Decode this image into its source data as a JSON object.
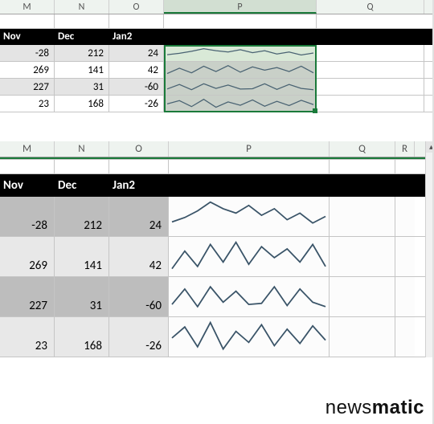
{
  "top": {
    "columns": {
      "M": "M",
      "N": "N",
      "O": "O",
      "P": "P",
      "Q": "Q"
    },
    "months": {
      "nov": "Nov",
      "dec": "Dec",
      "jan2": "Jan2"
    },
    "rows": [
      {
        "nov": "-28",
        "dec": "212",
        "jan2": "24"
      },
      {
        "nov": "269",
        "dec": "141",
        "jan2": "42"
      },
      {
        "nov": "227",
        "dec": "31",
        "jan2": "-60"
      },
      {
        "nov": "23",
        "dec": "168",
        "jan2": "-26"
      }
    ],
    "selected_column": "P"
  },
  "bot": {
    "columns": {
      "M": "M",
      "N": "N",
      "O": "O",
      "P": "P",
      "Q": "Q",
      "R": "R"
    },
    "months": {
      "nov": "Nov",
      "dec": "Dec",
      "jan2": "Jan2"
    },
    "rows": [
      {
        "nov": "-28",
        "dec": "212",
        "jan2": "24"
      },
      {
        "nov": "269",
        "dec": "141",
        "jan2": "42"
      },
      {
        "nov": "227",
        "dec": "31",
        "jan2": "-60"
      },
      {
        "nov": "23",
        "dec": "168",
        "jan2": "-26"
      }
    ]
  },
  "watermark": {
    "left": "news",
    "right": "matic"
  },
  "colors": {
    "excel_green": "#1a7a3a",
    "header_bg": "#eef3ef",
    "shade_dark": "#bdbdbd",
    "shade_light": "#e8e8e8",
    "sparkline": "#3a5468"
  },
  "chart_data": [
    {
      "type": "line",
      "title": "Row 1 sparkline",
      "x": [
        1,
        2,
        3,
        4,
        5,
        6,
        7,
        8,
        9,
        10,
        11,
        12,
        13
      ],
      "values": [
        10,
        14,
        20,
        28,
        22,
        18,
        25,
        16,
        22,
        12,
        18,
        9,
        15
      ],
      "ylim": [
        0,
        30
      ]
    },
    {
      "type": "line",
      "title": "Row 2 sparkline",
      "x": [
        1,
        2,
        3,
        4,
        5,
        6,
        7,
        8,
        9,
        10,
        11,
        12,
        13
      ],
      "values": [
        4,
        20,
        6,
        26,
        10,
        28,
        8,
        24,
        14,
        22,
        10,
        26,
        6
      ],
      "ylim": [
        0,
        30
      ]
    },
    {
      "type": "line",
      "title": "Row 3 sparkline",
      "x": [
        1,
        2,
        3,
        4,
        5,
        6,
        7,
        8,
        9,
        10,
        11,
        12,
        13
      ],
      "values": [
        8,
        22,
        6,
        24,
        10,
        20,
        8,
        9,
        24,
        7,
        22,
        10,
        6
      ],
      "ylim": [
        0,
        30
      ]
    },
    {
      "type": "line",
      "title": "Row 4 sparkline",
      "x": [
        1,
        2,
        3,
        4,
        5,
        6,
        7,
        8,
        9,
        10,
        11,
        12,
        13
      ],
      "values": [
        14,
        24,
        6,
        28,
        4,
        20,
        10,
        26,
        7,
        22,
        9,
        25,
        12
      ],
      "ylim": [
        0,
        30
      ]
    }
  ]
}
